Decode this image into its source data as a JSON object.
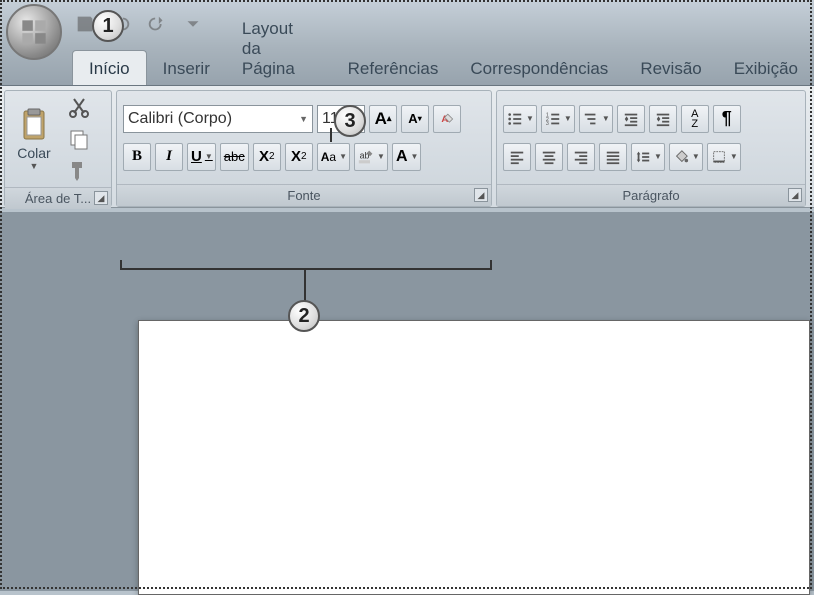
{
  "tabs": {
    "inicio": "Início",
    "inserir": "Inserir",
    "layout": "Layout da Página",
    "referencias": "Referências",
    "corresp": "Correspondências",
    "revisao": "Revisão",
    "exibicao": "Exibição"
  },
  "clipboard": {
    "paste_label": "Colar",
    "group_label": "Área de T..."
  },
  "font": {
    "name": "Calibri (Corpo)",
    "size": "11",
    "group_label": "Fonte",
    "bold": "B",
    "italic": "I",
    "underline": "U",
    "strike": "abc",
    "sub": "X",
    "sub2": "2",
    "sup": "X",
    "sup2": "2",
    "changecase": "Aa",
    "grow": "A",
    "shrink": "A",
    "clear": "A",
    "highlight": "ab",
    "color": "A"
  },
  "paragraph": {
    "group_label": "Parágrafo",
    "sort": "A",
    "sort2": "Z",
    "pilcrow": "¶"
  },
  "callouts": {
    "c1": "1",
    "c2": "2",
    "c3": "3"
  }
}
